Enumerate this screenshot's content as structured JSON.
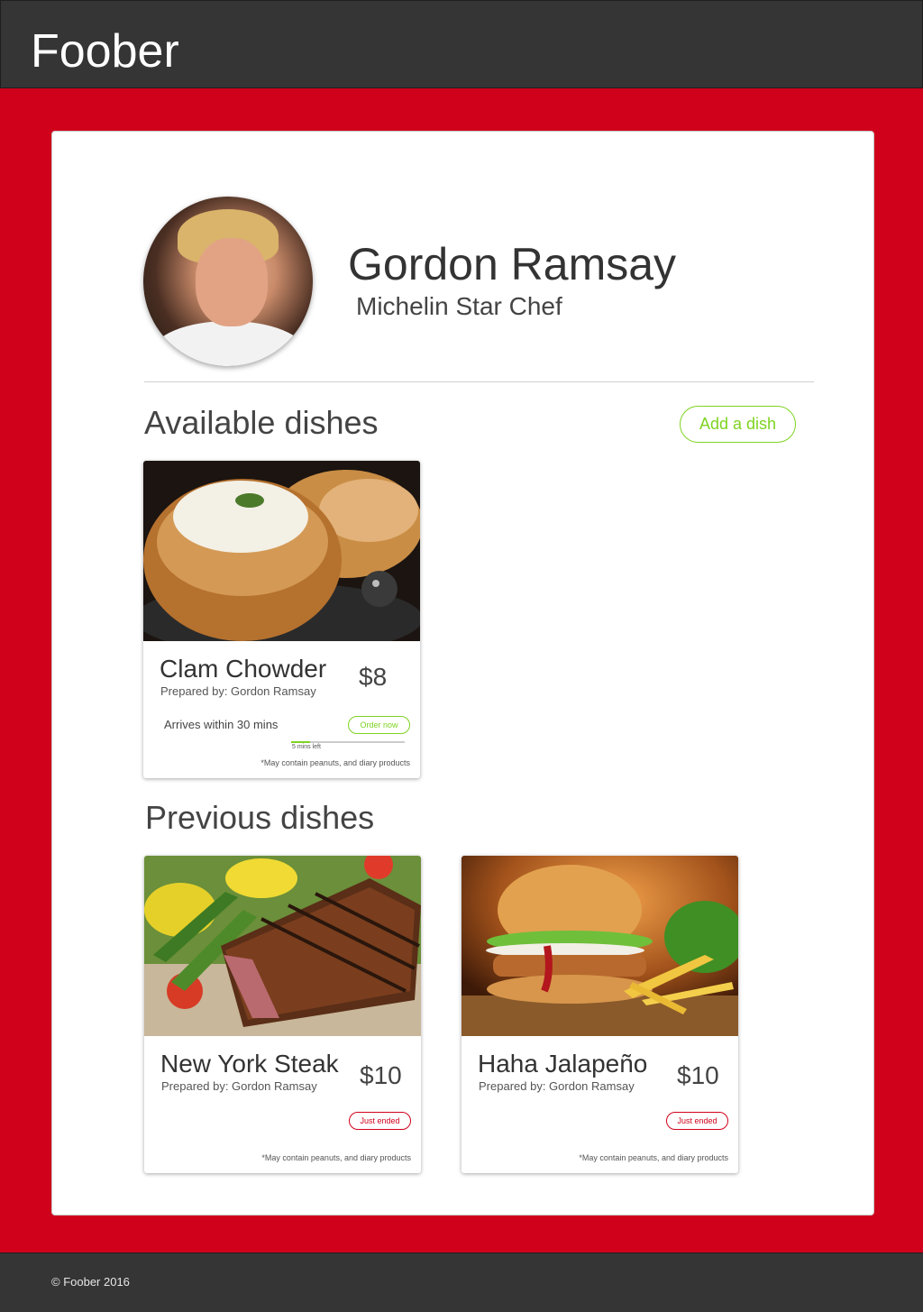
{
  "header": {
    "brand": "Foober"
  },
  "profile": {
    "name": "Gordon Ramsay",
    "title": "Michelin Star Chef"
  },
  "available": {
    "heading": "Available dishes",
    "add_button": "Add a dish",
    "dishes": [
      {
        "name": "Clam Chowder",
        "prepared_by": "Prepared by: Gordon Ramsay",
        "price": "$8",
        "arrives": "Arrives within 30 mins",
        "order_label": "Order now",
        "progress": 0.17,
        "time_left": "5 mins left",
        "disclaimer": "*May contain peanuts, and diary products"
      }
    ]
  },
  "previous": {
    "heading": "Previous dishes",
    "dishes": [
      {
        "name": "New York Steak",
        "prepared_by": "Prepared by: Gordon Ramsay",
        "price": "$10",
        "status": "Just ended",
        "disclaimer": "*May contain peanuts, and diary products"
      },
      {
        "name": "Haha Jalapeño",
        "prepared_by": "Prepared by: Gordon Ramsay",
        "price": "$10",
        "status": "Just ended",
        "disclaimer": "*May contain peanuts, and diary products"
      }
    ]
  },
  "footer": {
    "copyright": "© Foober 2016"
  },
  "colors": {
    "accent_red": "#d0021b",
    "accent_green": "#7ed321",
    "header_bg": "#353535"
  }
}
